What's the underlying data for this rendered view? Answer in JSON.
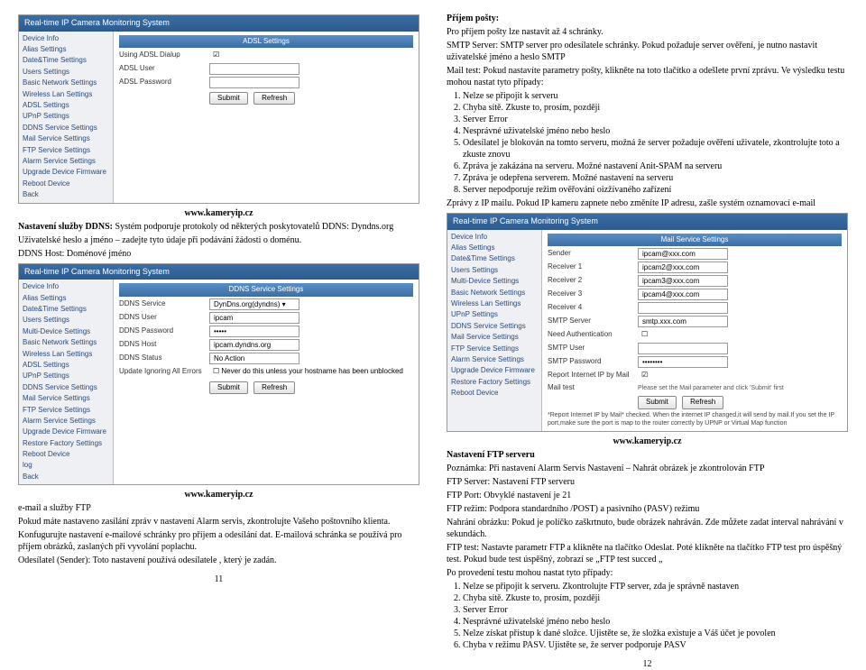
{
  "left": {
    "shot1": {
      "title": "Real-time IP Camera Monitoring System",
      "nav": [
        "Device Info",
        "Alias Settings",
        "Date&Time Settings",
        "Users Settings",
        "Basic Network Settings",
        "Wireless Lan Settings",
        "ADSL Settings",
        "UPnP Settings",
        "DDNS Service Settings",
        "Mail Service Settings",
        "FTP Service Settings",
        "Alarm Service Settings",
        "Upgrade Device Firmware",
        "Reboot Device",
        "Back"
      ],
      "section": "ADSL Settings",
      "rows": [
        {
          "label": "Using ADSL Dialup",
          "value": "☑"
        },
        {
          "label": "ADSL User",
          "value": ""
        },
        {
          "label": "ADSL Password",
          "value": ""
        }
      ],
      "buttons": [
        "Submit",
        "Refresh"
      ]
    },
    "url": "www.kameryip.cz",
    "p1": "Nastavení služby DDNS: Systém podporuje protokoly od některých poskytovatelů DDNS: Dyndns.org",
    "p2": "Uživatelské heslo a jméno – zadejte tyto údaje při podávání žádosti o doménu.",
    "p3": "DDNS Host: Doménové jméno",
    "shot2": {
      "title": "Real-time IP Camera Monitoring System",
      "nav": [
        "Device Info",
        "Alias Settings",
        "Date&Time Settings",
        "Users Settings",
        "Multi-Device Settings",
        "Basic Network Settings",
        "Wireless Lan Settings",
        "ADSL Settings",
        "UPnP Settings",
        "DDNS Service Settings",
        "Mail Service Settings",
        "FTP Service Settings",
        "Alarm Service Settings",
        "Upgrade Device Firmware",
        "Restore Factory Settings",
        "Reboot Device",
        "log",
        "Back"
      ],
      "section": "DDNS Service Settings",
      "rows": [
        {
          "label": "DDNS Service",
          "value": "DynDns.org(dyndns) ▾"
        },
        {
          "label": "DDNS User",
          "value": "ipcam"
        },
        {
          "label": "DDNS Password",
          "value": "•••••"
        },
        {
          "label": "DDNS Host",
          "value": "ipcam.dyndns.org"
        },
        {
          "label": "DDNS Status",
          "value": "No Action"
        },
        {
          "label": "Update Ignoring All Errors",
          "value": "☐ Never do this unless your hostname has been unblocked"
        }
      ],
      "buttons": [
        "Submit",
        "Refresh"
      ]
    },
    "p4": "e-mail a služby FTP",
    "p5": "Pokud máte nastaveno zasílání zpráv v nastavení Alarm servis, zkontrolujte Vašeho poštovního klienta.",
    "p6": "Konfugurujte nastavení e-mailové schránky pro příjem a odesílání dat. E-mailová schránka se používá pro příjem obrázků, zaslaných při vyvolání poplachu.",
    "p7": "Odesílatel (Sender): Toto nastavení používá odesílatele , který je zadán.",
    "pageNum": "11"
  },
  "right": {
    "h1": "Příjem pošty:",
    "p1": "Pro příjem pošty lze nastavit až 4 schránky.",
    "p2": "SMTP Server: SMTP server pro odesílatele schránky. Pokud požaduje server ověření, je nutno nastavit uživatelské jméno a heslo SMTP",
    "p3": "Mail test: Pokud nastavíte parametry pošty, klikněte na toto tlačítko a odešlete první zprávu. Ve výsledku testu mohou nastat tyto případy:",
    "list1": [
      "Nelze se připojit k serveru",
      "Chyba sítě. Zkuste to, prosím, později",
      "Server Error",
      "Nesprávné uživatelské jméno nebo heslo",
      "Odesílatel je blokován na tomto serveru, možná že server požaduje ověření uživatele, zkontrolujte toto a zkuste znovu",
      "Zpráva je zakázána na serveru. Možné nastavení Anit-SPAM  na serveru",
      "Zpráva je odepřena serverem. Možné nastavení na serveru",
      "Server nepodporuje režim ověřování oizžívaného zařízení"
    ],
    "p4": "Zprávy z IP mailu. Pokud IP kameru zapnete nebo změníte IP adresu, zašle systém oznamovací e-mail",
    "shot3": {
      "title": "Real-time IP Camera Monitoring System",
      "nav": [
        "Device Info",
        "Alias Settings",
        "Date&Time Settings",
        "Users Settings",
        "Multi-Device Settings",
        "Basic Network Settings",
        "Wireless Lan Settings",
        "UPnP Settings",
        "DDNS Service Settings",
        "Mail Service Settings",
        "FTP Service Settings",
        "Alarm Service Settings",
        "Upgrade Device Firmware",
        "Restore Factory Settings",
        "Reboot Device"
      ],
      "section": "Mail Service Settings",
      "rows": [
        {
          "label": "Sender",
          "value": "ipcam@xxx.com"
        },
        {
          "label": "Receiver 1",
          "value": "ipcam2@xxx.com"
        },
        {
          "label": "Receiver 2",
          "value": "ipcam3@xxx.com"
        },
        {
          "label": "Receiver 3",
          "value": "ipcam4@xxx.com"
        },
        {
          "label": "Receiver 4",
          "value": ""
        },
        {
          "label": "SMTP Server",
          "value": "smtp.xxx.com"
        },
        {
          "label": "Need Authentication",
          "value": "☐"
        },
        {
          "label": "SMTP User",
          "value": ""
        },
        {
          "label": "SMTP Password",
          "value": "••••••••"
        },
        {
          "label": "Report Internet IP by Mail",
          "value": "☑"
        }
      ],
      "mailTestLabel": "Mail test",
      "mailTestNote": "Please set the Mail parameter and click 'Submit' first",
      "bottomNote": "*Report Internet IP by Mail* checked. When the internet IP changed,it will send by mail.If you set the IP port,make sure the port is map to the router correctly by UPNP or Virtual Map function",
      "buttons": [
        "Submit",
        "Refresh"
      ]
    },
    "url": "www.kameryip.cz",
    "h2": "Nastavení FTP serveru",
    "p5": "Poznámka: Při nastavení Alarm Servis Nastavení – Nahrát obrázek  je zkontrolován FTP",
    "p6": "FTP Server: Nastavení FTP serveru",
    "p7": "FTP Port: Obvyklé nastavení je 21",
    "p8": "FTP režim: Podpora standardního /POST) a pasivního (PASV) režimu",
    "p9": "Nahrání obrázku: Pokud je políčko zaškrtnuto, bude obrázek nahráván. Zde můžete zadat interval nahrávání v sekundách.",
    "p10": "FTP test: Nastavte parametr FTP a klikněte na tlačítko Odeslat. Poté klikněte na tlačítko FTP test pro úspěšný test. Pokud bude test úspěšný, zobrazí se „FTP test succed „",
    "p11": "Po provedení testu mohou nastat tyto případy:",
    "list2": [
      "Nelze se připojit k serveru. Zkontrolujte FTP server, zda je správně nastaven",
      "Chyba sítě. Zkuste to, prosím, později",
      "Server Error",
      "Nesprávné uživatelské jméno nebo heslo",
      "Nelze získat přístup k dané složce. Ujistěte se, že složka existuje a Váš účet je povolen",
      "Chyba v režimu PASV. Ujistěte se, že server podporuje PASV"
    ],
    "pageNum": "12"
  }
}
